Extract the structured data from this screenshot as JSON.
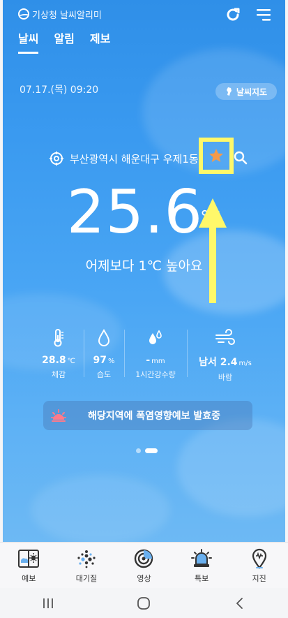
{
  "app": {
    "logo_text": "기상청 날씨알리미"
  },
  "tabs": [
    {
      "label": "날씨"
    },
    {
      "label": "알림"
    },
    {
      "label": "제보"
    }
  ],
  "date_time": "07.17.(목) 09:20",
  "map_button": "날씨지도",
  "location": {
    "name": "부산광역시 해운대구 우제1동"
  },
  "temperature": {
    "value": "25.6",
    "unit": "℃"
  },
  "comparison": "어제보다 1℃ 높아요",
  "stats": [
    {
      "icon": "thermometer-icon",
      "value": "28.8",
      "unit": "℃",
      "label": "체감"
    },
    {
      "icon": "humidity-drop-icon",
      "value": "97",
      "unit": "%",
      "label": "습도"
    },
    {
      "icon": "rain-drops-icon",
      "value": "-",
      "unit": "mm",
      "label": "1시간강수량"
    },
    {
      "icon": "wind-icon",
      "value": "남서 2.4",
      "unit": "m/s",
      "label": "바람"
    }
  ],
  "alert": {
    "icon": "heat-sun-icon",
    "text": "해당지역에 폭염영향예보 발효중"
  },
  "pagination": {
    "count": 2,
    "active": 1
  },
  "bottom_nav": [
    {
      "label": "예보",
      "icon": "forecast-icon"
    },
    {
      "label": "대기질",
      "icon": "air-quality-icon"
    },
    {
      "label": "영상",
      "icon": "video-icon"
    },
    {
      "label": "특보",
      "icon": "warning-siren-icon"
    },
    {
      "label": "지진",
      "icon": "earthquake-pin-icon"
    }
  ],
  "colors": {
    "highlight": "#fff86a",
    "star": "#f59a4a",
    "alert_icon": "#ff7a8a"
  }
}
